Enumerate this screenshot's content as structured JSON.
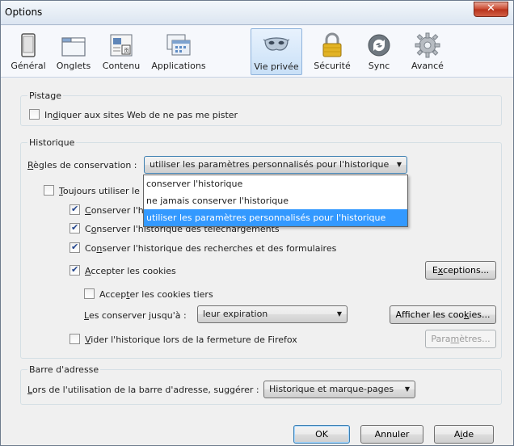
{
  "window": {
    "title": "Options",
    "close_label": "✕"
  },
  "toolbar": {
    "items": [
      {
        "label": "Général",
        "icon": "general-icon"
      },
      {
        "label": "Onglets",
        "icon": "tabs-icon"
      },
      {
        "label": "Contenu",
        "icon": "content-icon"
      },
      {
        "label": "Applications",
        "icon": "applications-icon"
      },
      {
        "label": "Vie privée",
        "icon": "privacy-mask-icon",
        "selected": true
      },
      {
        "label": "Sécurité",
        "icon": "security-lock-icon"
      },
      {
        "label": "Sync",
        "icon": "sync-icon"
      },
      {
        "label": "Avancé",
        "icon": "advanced-gear-icon"
      }
    ]
  },
  "tracking": {
    "title": "Pistage",
    "dnt_label_pre": "In",
    "dnt_label_u": "d",
    "dnt_label_post": "iquer aux sites Web de ne pas me pister",
    "dnt_checked": false
  },
  "history": {
    "title": "Historique",
    "rules_label_u": "R",
    "rules_label_post": "ègles de conservation :",
    "rules_value": "utiliser les paramètres personnalisés pour l'historique",
    "dropdown_options": [
      "conserver l'historique",
      "ne jamais conserver l'historique",
      "utiliser les paramètres personnalisés pour l'historique"
    ],
    "always_private_u": "T",
    "always_private_post": "oujours utiliser le",
    "keep_browsing_u": "C",
    "keep_browsing_post": "onserver l'h",
    "keep_downloads_u": "o",
    "keep_downloads_pre": "C",
    "keep_downloads_post": "nserver l'historique des téléchargements",
    "keep_forms_pre": "Co",
    "keep_forms_u": "n",
    "keep_forms_post": "server l'historique des recherches et des formulaires",
    "accept_cookies_u": "A",
    "accept_cookies_post": "ccepter les cookies",
    "exceptions_pre": "E",
    "exceptions_u": "x",
    "exceptions_post": "ceptions...",
    "third_party_pre": "Accep",
    "third_party_u": "t",
    "third_party_post": "er les cookies tiers",
    "keep_until_u": "L",
    "keep_until_post": "es conserver jusqu'à :",
    "keep_until_value": "leur expiration",
    "show_cookies_pre": "Afficher les coo",
    "show_cookies_u": "k",
    "show_cookies_post": "ies...",
    "clear_on_close_u": "V",
    "clear_on_close_post": "ider l'historique lors de la fermeture de Firefox",
    "settings_pre": "Para",
    "settings_u": "m",
    "settings_post": "ètres..."
  },
  "addressbar": {
    "title": "Barre d'adresse",
    "label_u": "L",
    "label_post": "ors de l'utilisation de la barre d'adresse, suggérer :",
    "value": "Historique et marque-pages"
  },
  "footer": {
    "ok": "OK",
    "cancel": "Annuler",
    "help_pre": "A",
    "help_u": "i",
    "help_post": "de"
  }
}
